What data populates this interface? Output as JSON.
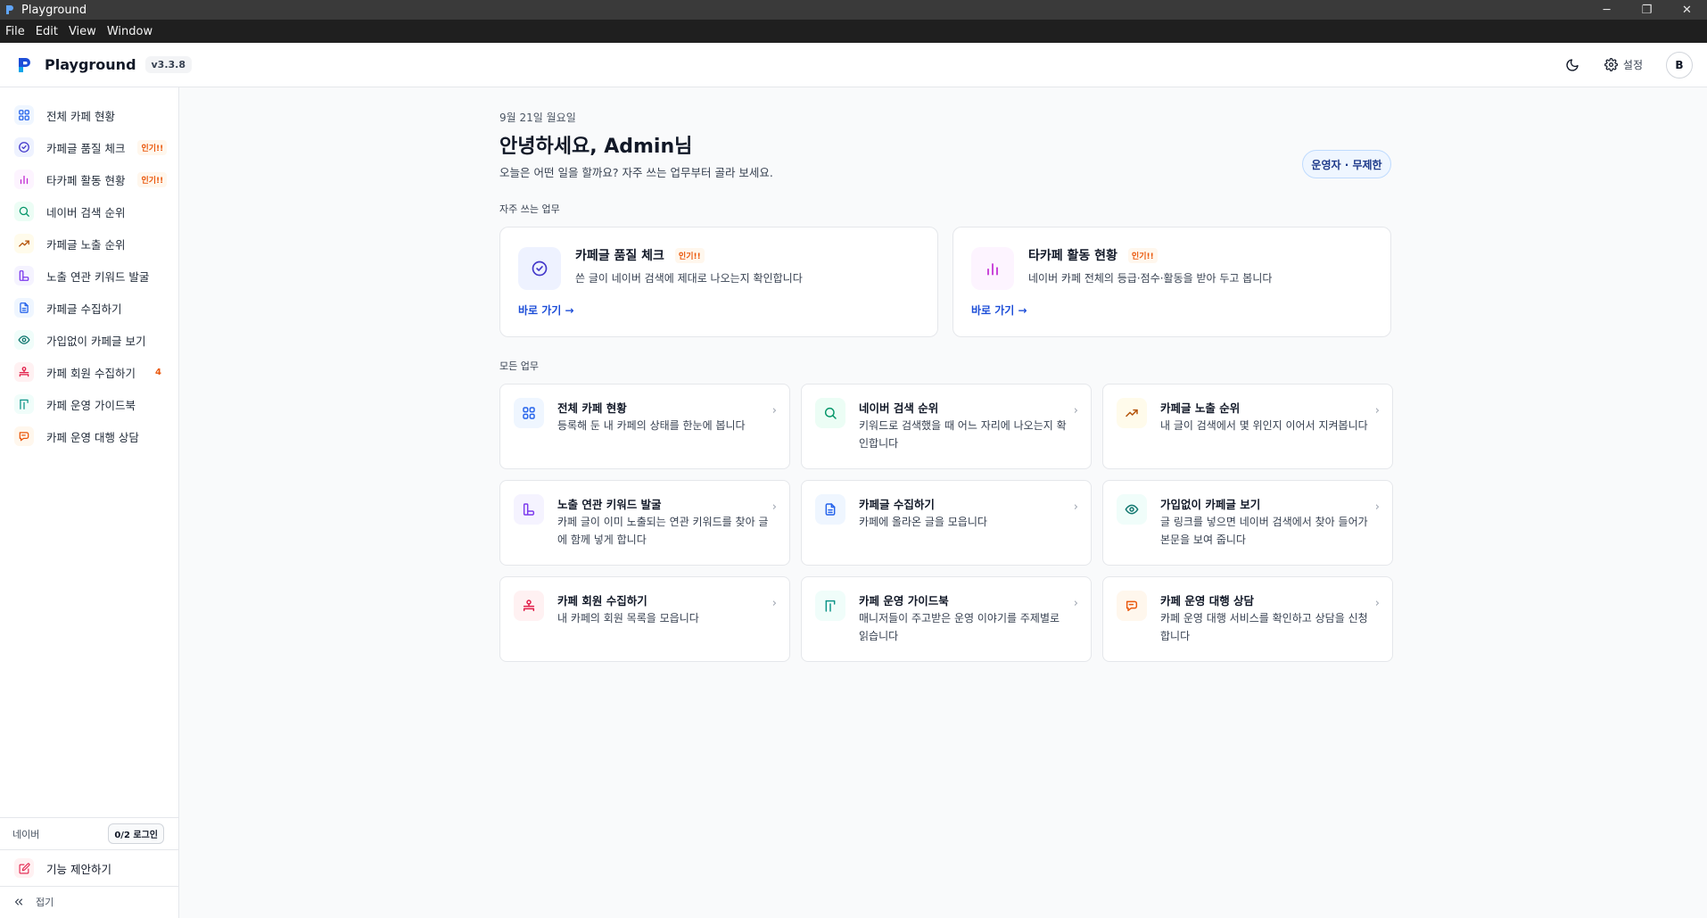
{
  "window": {
    "title": "Playground",
    "controls": [
      "─",
      "❐",
      "✕"
    ]
  },
  "menu": [
    "File",
    "Edit",
    "View",
    "Window"
  ],
  "header": {
    "brand": "Playground",
    "version": "v3.3.8",
    "settings_label": "설정",
    "avatar_initial": "B"
  },
  "sidebar": {
    "items": [
      {
        "label": "전체 카페 현황",
        "icon": "grid-icon",
        "color": "#2563eb",
        "bg": "#eff6ff",
        "badge": ""
      },
      {
        "label": "카페글 품질 체크",
        "icon": "check-circle-icon",
        "color": "#4338ca",
        "bg": "#eef2ff",
        "badge": "인기!!"
      },
      {
        "label": "타카페 활동 현황",
        "icon": "bar-chart-icon",
        "color": "#c026d3",
        "bg": "#fdf4ff",
        "badge": "인기!!"
      },
      {
        "label": "네이버 검색 순위",
        "icon": "search-icon",
        "color": "#059669",
        "bg": "#ecfdf5",
        "badge": ""
      },
      {
        "label": "카페글 노출 순위",
        "icon": "trending-up-icon",
        "color": "#b45309",
        "bg": "#fffbeb",
        "badge": ""
      },
      {
        "label": "노출 연관 키워드 발굴",
        "icon": "keyword-icon",
        "color": "#7c3aed",
        "bg": "#f5f3ff",
        "badge": ""
      },
      {
        "label": "카페글 수집하기",
        "icon": "document-icon",
        "color": "#2563eb",
        "bg": "#eff6ff",
        "badge": ""
      },
      {
        "label": "가입없이 카페글 보기",
        "icon": "eye-icon",
        "color": "#0f766e",
        "bg": "#f0fdfa",
        "badge": ""
      },
      {
        "label": "카페 회원 수집하기",
        "icon": "members-icon",
        "color": "#e11d48",
        "bg": "#fff1f2",
        "badge": ""
      },
      {
        "label": "카페 운영 가이드북",
        "icon": "book-icon",
        "color": "#0d9488",
        "bg": "#f0fdfa",
        "badge": ""
      },
      {
        "label": "카페 운영 대행 상담",
        "icon": "chat-icon",
        "color": "#ea580c",
        "bg": "#fff7ed",
        "badge": ""
      }
    ],
    "members_count": "4",
    "naver_label": "네이버",
    "login_status": "0/2 로그인",
    "suggest_label": "기능 제안하기",
    "collapse_label": "접기"
  },
  "main": {
    "date": "9월 21일 월요일",
    "greeting": "안녕하세요, Admin님",
    "subtitle": "오늘은 어떤 일을 할까요? 자주 쓰는 업무부터 골라 보세요.",
    "role_badge": "운영자 · 무제한",
    "favorites_label": "자주 쓰는 업무",
    "favorites": [
      {
        "title": "카페글 품질 체크",
        "badge": "인기!!",
        "desc": "쓴 글이 네이버 검색에 제대로 나오는지 확인합니다",
        "link": "바로 가기 →"
      },
      {
        "title": "타카페 활동 현황",
        "badge": "인기!!",
        "desc": "네이버 카페 전체의 등급·점수·활동을 받아 두고 봅니다",
        "link": "바로 가기 →"
      }
    ],
    "all_label": "모든 업무",
    "tasks": [
      {
        "title": "전체 카페 현황",
        "desc": "등록해 둔 내 카페의 상태를 한눈에 봅니다"
      },
      {
        "title": "네이버 검색 순위",
        "desc": "키워드로 검색했을 때 어느 자리에 나오는지 확인합니다"
      },
      {
        "title": "카페글 노출 순위",
        "desc": "내 글이 검색에서 몇 위인지 이어서 지켜봅니다"
      },
      {
        "title": "노출 연관 키워드 발굴",
        "desc": "카페 글이 이미 노출되는 연관 키워드를 찾아 글에 함께 넣게 합니다"
      },
      {
        "title": "카페글 수집하기",
        "desc": "카페에 올라온 글을 모읍니다"
      },
      {
        "title": "가입없이 카페글 보기",
        "desc": "글 링크를 넣으면 네이버 검색에서 찾아 들어가 본문을 보여 줍니다"
      },
      {
        "title": "카페 회원 수집하기",
        "desc": "내 카페의 회원 목록을 모읍니다"
      },
      {
        "title": "카페 운영 가이드북",
        "desc": "매니저들이 주고받은 운영 이야기를 주제별로 읽습니다"
      },
      {
        "title": "카페 운영 대행 상담",
        "desc": "카페 운영 대행 서비스를 확인하고 상담을 신청합니다"
      }
    ]
  }
}
